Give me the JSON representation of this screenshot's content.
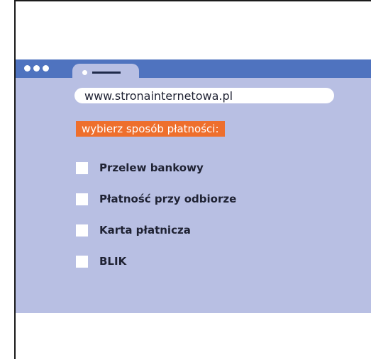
{
  "browser": {
    "url": "www.stronainternetowa.pl"
  },
  "payment": {
    "heading": "wybierz sposób płatności:",
    "options": [
      {
        "label": "Przelew bankowy",
        "checked": false
      },
      {
        "label": "Płatność przy odbiorze",
        "checked": false
      },
      {
        "label": "Karta płatnicza",
        "checked": false
      },
      {
        "label": "BLIK",
        "checked": false
      }
    ]
  },
  "colors": {
    "titlebar": "#4f73bf",
    "page_background": "#b8bfe3",
    "heading_background": "#ee6f2d",
    "frame_border": "#1a1a1a"
  }
}
